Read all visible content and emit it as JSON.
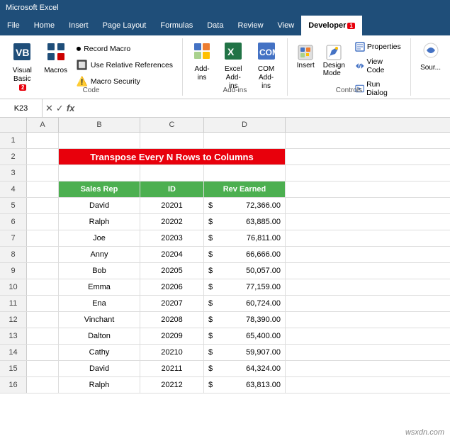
{
  "titlebar": {
    "text": "Microsoft Excel"
  },
  "tabs": [
    {
      "label": "File",
      "active": false
    },
    {
      "label": "Home",
      "active": false
    },
    {
      "label": "Insert",
      "active": false
    },
    {
      "label": "Page Layout",
      "active": false
    },
    {
      "label": "Formulas",
      "active": false
    },
    {
      "label": "Data",
      "active": false
    },
    {
      "label": "Review",
      "active": false
    },
    {
      "label": "View",
      "active": false
    },
    {
      "label": "Developer",
      "active": true
    }
  ],
  "ribbon": {
    "code_group": {
      "label": "Code",
      "visual_basic_label": "Visual\nBasic",
      "macros_label": "Macros",
      "vb_number": "2",
      "record_macro": "Record Macro",
      "use_relative": "Use Relative References",
      "macro_security": "Macro Security"
    },
    "addins_group": {
      "label": "Add-ins",
      "addins_label": "Add-\nins",
      "excel_addins_label": "Excel\nAdd-ins",
      "com_addins_label": "COM\nAdd-ins"
    },
    "controls_group": {
      "label": "Controls",
      "insert_label": "Insert",
      "design_mode_label": "Design\nMode",
      "properties_label": "Properties",
      "view_code_label": "View Code",
      "run_dialog_label": "Run Dialog"
    },
    "source_label": "Sour..."
  },
  "formula_bar": {
    "cell_ref": "K23",
    "fx_symbol": "fx"
  },
  "spreadsheet": {
    "col_headers": [
      "A",
      "B",
      "C",
      "D"
    ],
    "title": "Transpose Every N Rows to Columns",
    "table_headers": [
      "Sales Rep",
      "ID",
      "Rev Earned"
    ],
    "rows": [
      {
        "num": 1,
        "a": "",
        "b": "",
        "c": "",
        "d": ""
      },
      {
        "num": 2,
        "b_span": "Transpose Every N Rows to Columns"
      },
      {
        "num": 3,
        "a": "",
        "b": "",
        "c": "",
        "d": ""
      },
      {
        "num": 4,
        "b": "Sales Rep",
        "c": "ID",
        "d": "Rev Earned",
        "header": true
      },
      {
        "num": 5,
        "b": "David",
        "c": "20201",
        "d_sym": "$",
        "d_val": "72,366.00"
      },
      {
        "num": 6,
        "b": "Ralph",
        "c": "20202",
        "d_sym": "$",
        "d_val": "63,885.00"
      },
      {
        "num": 7,
        "b": "Joe",
        "c": "20203",
        "d_sym": "$",
        "d_val": "76,811.00"
      },
      {
        "num": 8,
        "b": "Anny",
        "c": "20204",
        "d_sym": "$",
        "d_val": "66,666.00"
      },
      {
        "num": 9,
        "b": "Bob",
        "c": "20205",
        "d_sym": "$",
        "d_val": "50,057.00"
      },
      {
        "num": 10,
        "b": "Emma",
        "c": "20206",
        "d_sym": "$",
        "d_val": "77,159.00"
      },
      {
        "num": 11,
        "b": "Ena",
        "c": "20207",
        "d_sym": "$",
        "d_val": "60,724.00"
      },
      {
        "num": 12,
        "b": "Vinchant",
        "c": "20208",
        "d_sym": "$",
        "d_val": "78,390.00"
      },
      {
        "num": 13,
        "b": "Dalton",
        "c": "20209",
        "d_sym": "$",
        "d_val": "65,400.00"
      },
      {
        "num": 14,
        "b": "Cathy",
        "c": "20210",
        "d_sym": "$",
        "d_val": "59,907.00"
      },
      {
        "num": 15,
        "b": "David",
        "c": "20211",
        "d_sym": "$",
        "d_val": "64,324.00"
      },
      {
        "num": 16,
        "b": "Ralph",
        "c": "20212",
        "d_sym": "$",
        "d_val": "63,813.00"
      }
    ]
  },
  "watermark": "wsxdn.com"
}
